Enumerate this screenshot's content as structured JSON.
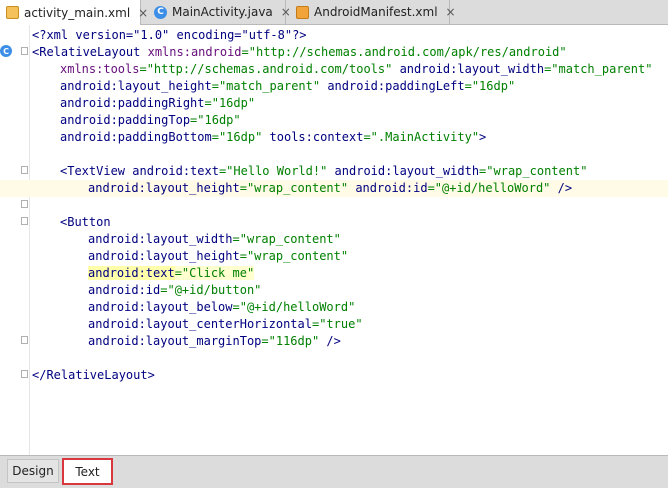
{
  "tabs": [
    {
      "label": "activity_main.xml",
      "icon": "xml-file-icon",
      "active": true
    },
    {
      "label": "MainActivity.java",
      "icon": "class-c-icon",
      "active": false
    },
    {
      "label": "AndroidManifest.xml",
      "icon": "manifest-file-icon",
      "active": false
    }
  ],
  "close_glyph": "×",
  "gutter_badge": "C",
  "code": {
    "l1": "<?xml version=\"1.0\" encoding=\"utf-8\"?>",
    "l2_tag": "<RelativeLayout ",
    "l2_ns": "xmlns:android",
    "l2_eq": "=",
    "l2_val": "\"http://schemas.android.com/apk/res/android\"",
    "l3_a1": "xmlns:tools",
    "l3_v1": "=\"http://schemas.android.com/tools\"",
    "l3_a2": " android:layout_width",
    "l3_v2": "=\"match_parent\"",
    "l4_a1": "android:layout_height",
    "l4_v1": "=\"match_parent\"",
    "l4_a2": " android:paddingLeft",
    "l4_v2": "=\"16dp\"",
    "l5_a": "android:paddingRight",
    "l5_v": "=\"16dp\"",
    "l6_a": "android:paddingTop",
    "l6_v": "=\"16dp\"",
    "l7_a1": "android:paddingBottom",
    "l7_v1": "=\"16dp\"",
    "l7_a2": " tools:context",
    "l7_v2": "=\".MainActivity\"",
    "l7_end": ">",
    "l9_tag": "<TextView ",
    "l9_a1": "android:text",
    "l9_v1": "=\"Hello World!\"",
    "l9_a2": " android:layout_width",
    "l9_v2": "=\"wrap_content\"",
    "l10_a1": "android:layout_height",
    "l10_v1": "=\"wrap_content\"",
    "l10_a2": " android:id",
    "l10_v2": "=\"@+id/helloWord\"",
    "l10_end": " />",
    "l12_tag": "<Button",
    "l13_a": "android:layout_width",
    "l13_v": "=\"wrap_content\"",
    "l14_a": "android:layout_height",
    "l14_v": "=\"wrap_content\"",
    "l15_a": "android:text",
    "l15_v": "=\"Click me\"",
    "l16_a": "android:id",
    "l16_v": "=\"@+id/button\"",
    "l17_a": "android:layout_below",
    "l17_v": "=\"@+id/helloWord\"",
    "l18_a": "android:layout_centerHorizontal",
    "l18_v": "=\"true\"",
    "l19_a": "android:layout_marginTop",
    "l19_v": "=\"116dp\"",
    "l19_end": " />",
    "l21": "</RelativeLayout>"
  },
  "bottom_tabs": [
    {
      "label": "Design",
      "active": false
    },
    {
      "label": "Text",
      "active": true
    }
  ],
  "colors": {
    "tag": "#000080",
    "value": "#008000",
    "namespace": "#660e7a",
    "highlight_line": "#fffbe6",
    "selected_tab_border": "#d9363e"
  }
}
